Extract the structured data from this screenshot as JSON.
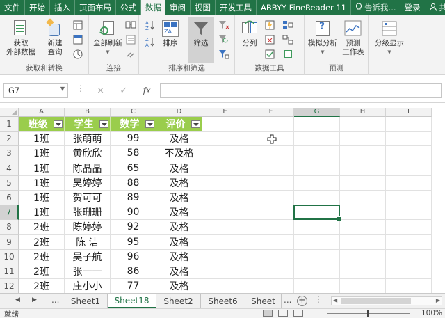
{
  "ribbon_tabs": [
    "文件",
    "开始",
    "插入",
    "页面布局",
    "公式",
    "数据",
    "审阅",
    "视图",
    "开发工具",
    "ABBYY FineReader 11"
  ],
  "active_tab": "数据",
  "tell_me": "告诉我...",
  "login": "登录",
  "share": "共享",
  "ribbon": {
    "get_external": "获取\n外部数据",
    "new_query": "新建\n查询",
    "group_get_transform": "获取和转换",
    "refresh_all": "全部刷新",
    "group_connections": "连接",
    "sort": "排序",
    "filter": "筛选",
    "group_sort_filter": "排序和筛选",
    "text_to_columns": "分列",
    "group_data_tools": "数据工具",
    "what_if": "模拟分析",
    "forecast_sheet": "预测\n工作表",
    "group_forecast": "预测",
    "outline": "分级显示"
  },
  "formula_bar": {
    "name_box": "G7",
    "cancel_icon": "×",
    "enter_icon": "✓",
    "fx_label": "fx",
    "formula": ""
  },
  "columns": [
    "A",
    "B",
    "C",
    "D",
    "E",
    "F",
    "G",
    "H",
    "I"
  ],
  "selected_column": "G",
  "selected_row": "7",
  "rows": [
    "1",
    "2",
    "3",
    "4",
    "5",
    "6",
    "7",
    "8",
    "9",
    "10",
    "11",
    "12"
  ],
  "table": {
    "headers": [
      "班级",
      "学生",
      "数学",
      "评价"
    ],
    "data": [
      [
        "1班",
        "张萌萌",
        "99",
        "及格"
      ],
      [
        "1班",
        "黄欣欣",
        "58",
        "不及格"
      ],
      [
        "1班",
        "陈晶晶",
        "65",
        "及格"
      ],
      [
        "1班",
        "吴婷婷",
        "88",
        "及格"
      ],
      [
        "1班",
        "贺可可",
        "89",
        "及格"
      ],
      [
        "1班",
        "张珊珊",
        "90",
        "及格"
      ],
      [
        "2班",
        "陈婷婷",
        "92",
        "及格"
      ],
      [
        "2班",
        "陈  洁",
        "95",
        "及格"
      ],
      [
        "2班",
        "吴子航",
        "96",
        "及格"
      ],
      [
        "2班",
        "张一一",
        "86",
        "及格"
      ],
      [
        "2班",
        "庄小小",
        "77",
        "及格"
      ]
    ]
  },
  "sheet_tabs": [
    "Sheet1",
    "Sheet18",
    "Sheet2",
    "Sheet6",
    "Sheet"
  ],
  "active_sheet": "Sheet18",
  "sheet_nav_more": "...",
  "status": {
    "ready": "就绪",
    "zoom": "100%"
  },
  "colors": {
    "excel_green": "#217346",
    "header_fill": "#9acd4c",
    "selection": "#217346"
  }
}
